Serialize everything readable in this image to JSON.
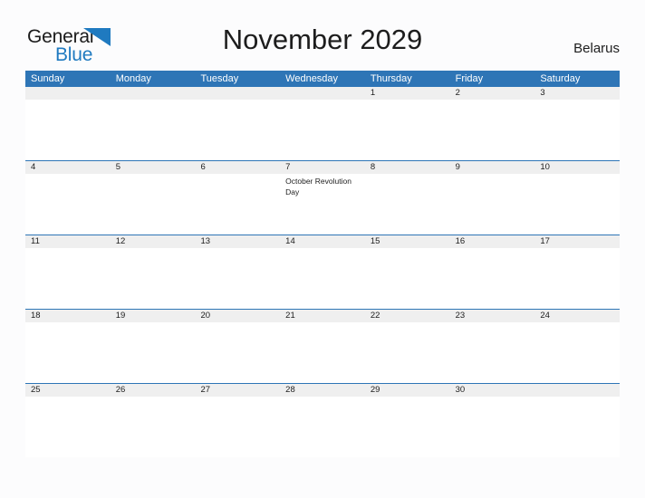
{
  "brand": {
    "name_part1": "General",
    "name_part2": "Blue",
    "flag_icon": "blue-flag-triangle",
    "color_dark": "#1b1b1b",
    "color_blue": "#1f7ac0"
  },
  "header": {
    "title": "November 2029",
    "country": "Belarus"
  },
  "theme": {
    "header_blue": "#2e75b6",
    "date_band_gray": "#efefef",
    "page_background": "#fcfcfd",
    "text_color": "#1d1d1d"
  },
  "calendar": {
    "weekdays": [
      "Sunday",
      "Monday",
      "Tuesday",
      "Wednesday",
      "Thursday",
      "Friday",
      "Saturday"
    ],
    "weeks": [
      {
        "days": [
          {
            "date": "",
            "event": ""
          },
          {
            "date": "",
            "event": ""
          },
          {
            "date": "",
            "event": ""
          },
          {
            "date": "",
            "event": ""
          },
          {
            "date": "1",
            "event": ""
          },
          {
            "date": "2",
            "event": ""
          },
          {
            "date": "3",
            "event": ""
          }
        ]
      },
      {
        "days": [
          {
            "date": "4",
            "event": ""
          },
          {
            "date": "5",
            "event": ""
          },
          {
            "date": "6",
            "event": ""
          },
          {
            "date": "7",
            "event": "October Revolution Day"
          },
          {
            "date": "8",
            "event": ""
          },
          {
            "date": "9",
            "event": ""
          },
          {
            "date": "10",
            "event": ""
          }
        ]
      },
      {
        "days": [
          {
            "date": "11",
            "event": ""
          },
          {
            "date": "12",
            "event": ""
          },
          {
            "date": "13",
            "event": ""
          },
          {
            "date": "14",
            "event": ""
          },
          {
            "date": "15",
            "event": ""
          },
          {
            "date": "16",
            "event": ""
          },
          {
            "date": "17",
            "event": ""
          }
        ]
      },
      {
        "days": [
          {
            "date": "18",
            "event": ""
          },
          {
            "date": "19",
            "event": ""
          },
          {
            "date": "20",
            "event": ""
          },
          {
            "date": "21",
            "event": ""
          },
          {
            "date": "22",
            "event": ""
          },
          {
            "date": "23",
            "event": ""
          },
          {
            "date": "24",
            "event": ""
          }
        ]
      },
      {
        "days": [
          {
            "date": "25",
            "event": ""
          },
          {
            "date": "26",
            "event": ""
          },
          {
            "date": "27",
            "event": ""
          },
          {
            "date": "28",
            "event": ""
          },
          {
            "date": "29",
            "event": ""
          },
          {
            "date": "30",
            "event": ""
          },
          {
            "date": "",
            "event": ""
          }
        ]
      }
    ]
  }
}
